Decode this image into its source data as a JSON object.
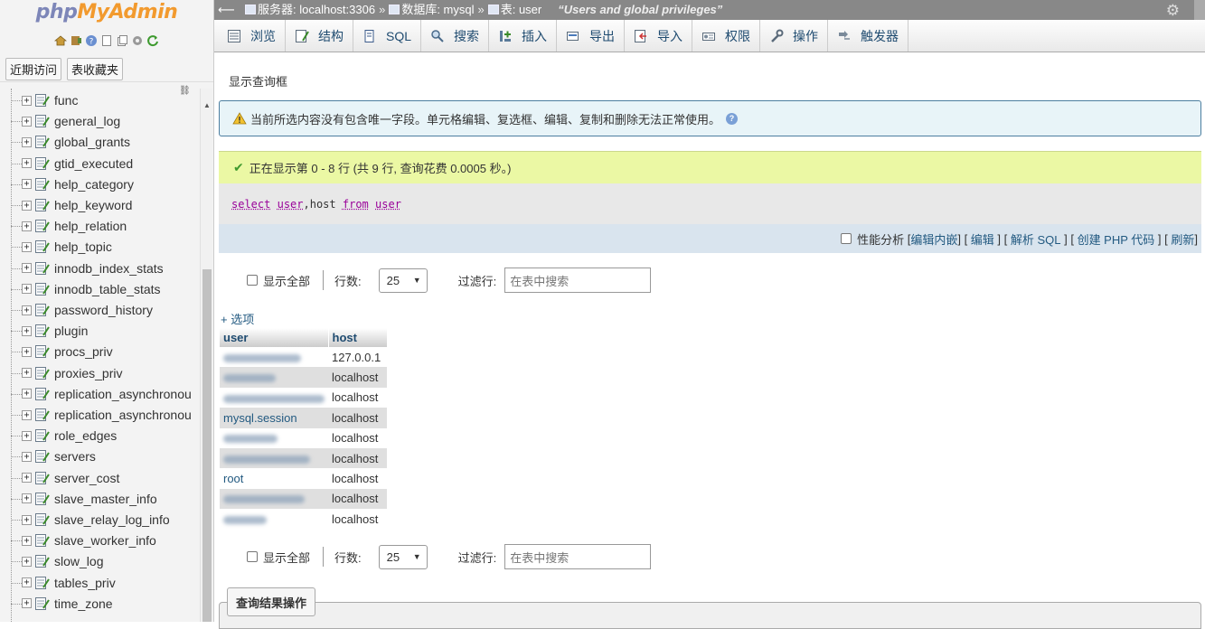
{
  "logo": {
    "part1": "php",
    "part2": "MyAdmin"
  },
  "nav": {
    "icons": [
      "home-icon",
      "exit-icon",
      "help-icon",
      "docs-icon",
      "copy-icon",
      "settings-icon",
      "reload-icon"
    ],
    "tabs": [
      "近期访问",
      "表收藏夹"
    ],
    "tables": [
      "func",
      "general_log",
      "global_grants",
      "gtid_executed",
      "help_category",
      "help_keyword",
      "help_relation",
      "help_topic",
      "innodb_index_stats",
      "innodb_table_stats",
      "password_history",
      "plugin",
      "procs_priv",
      "proxies_priv",
      "replication_asynchronou",
      "replication_asynchronou",
      "role_edges",
      "servers",
      "server_cost",
      "slave_master_info",
      "slave_relay_log_info",
      "slave_worker_info",
      "slow_log",
      "tables_priv",
      "time_zone"
    ]
  },
  "breadcrumb": {
    "server": "服务器: localhost:3306",
    "database": "数据库: mysql",
    "table": "表: user",
    "comment": "“Users and global privileges”",
    "sep": "»"
  },
  "menu": {
    "tabs": [
      {
        "label": "浏览",
        "icon": "browse-icon"
      },
      {
        "label": "结构",
        "icon": "structure-icon"
      },
      {
        "label": "SQL",
        "icon": "sql-icon"
      },
      {
        "label": "搜索",
        "icon": "search-icon"
      },
      {
        "label": "插入",
        "icon": "insert-icon"
      },
      {
        "label": "导出",
        "icon": "export-icon"
      },
      {
        "label": "导入",
        "icon": "import-icon"
      },
      {
        "label": "权限",
        "icon": "privileges-icon"
      },
      {
        "label": "操作",
        "icon": "operations-icon"
      },
      {
        "label": "触发器",
        "icon": "triggers-icon"
      }
    ]
  },
  "main": {
    "show_query": "显示查询框",
    "notice": "当前所选内容没有包含唯一字段。单元格编辑、复选框、编辑、复制和删除无法正常使用。",
    "success": "正在显示第 0 - 8 行 (共 9 行, 查询花费 0.0005 秒。)",
    "sql": {
      "kw1": "select",
      "col1": "user",
      "comma": ",",
      "col2": "host",
      "kw2": "from",
      "tbl": "user"
    },
    "profile": {
      "checkbox_label": "性能分析",
      "links": [
        "编辑内嵌",
        "编辑",
        "解析 SQL",
        "创建 PHP 代码",
        "刷新"
      ]
    },
    "nav_controls": {
      "show_all": "显示全部",
      "rows_label": "行数:",
      "rows_value": "25",
      "filter_label": "过滤行:",
      "filter_placeholder": "在表中搜索"
    },
    "options_link": "+ 选项",
    "columns": [
      "user",
      "host"
    ],
    "rows": [
      {
        "user": "",
        "host": "127.0.0.1",
        "blurred": true
      },
      {
        "user": "",
        "host": "localhost",
        "blurred": true
      },
      {
        "user": "",
        "host": "localhost",
        "blurred": true
      },
      {
        "user": "mysql.session",
        "host": "localhost",
        "blurred": false
      },
      {
        "user": "",
        "host": "localhost",
        "blurred": true
      },
      {
        "user": "",
        "host": "localhost",
        "blurred": true
      },
      {
        "user": "root",
        "host": "localhost",
        "blurred": false
      },
      {
        "user": "",
        "host": "localhost",
        "blurred": true
      },
      {
        "user": "",
        "host": "localhost",
        "blurred": true
      }
    ],
    "query_results_ops": "查询结果操作"
  },
  "colors": {
    "link": "#235a81",
    "success_bg": "#ebf8a4",
    "notice_bg": "#e8f4f8",
    "topbar": "#888888"
  }
}
